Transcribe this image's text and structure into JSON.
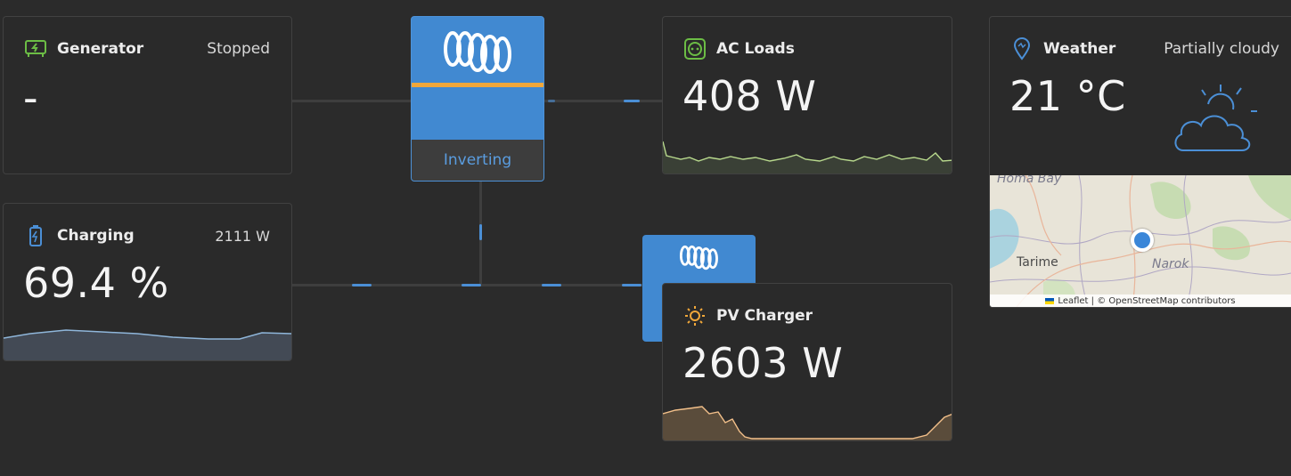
{
  "generator": {
    "title": "Generator",
    "status": "Stopped",
    "value": "-",
    "icon": "generator-icon",
    "icon_color": "#6cbd45"
  },
  "battery": {
    "title": "Charging",
    "power": "2111 W",
    "value": "69.4 %",
    "icon": "battery-icon",
    "icon_color": "#4b8fd6"
  },
  "inverter": {
    "state": "Inverting",
    "brand_color": "#4189d1",
    "accent_color": "#f0a73a"
  },
  "ac_loads": {
    "title": "AC Loads",
    "value": "408 W",
    "icon": "socket-icon",
    "icon_color": "#6cbd45"
  },
  "pv_charger": {
    "title": "PV Charger",
    "value": "2603 W",
    "icon": "sun-icon",
    "icon_color": "#f0a73a"
  },
  "weather": {
    "title": "Weather",
    "condition": "Partially cloudy",
    "temperature": "21 °C",
    "icon": "location-pin-icon",
    "condition_icon": "partly-cloudy-icon",
    "map": {
      "labels": [
        "Homa Bay",
        "Tarime",
        "Narok"
      ],
      "attribution": "Leaflet | © OpenStreetMap contributors"
    }
  }
}
